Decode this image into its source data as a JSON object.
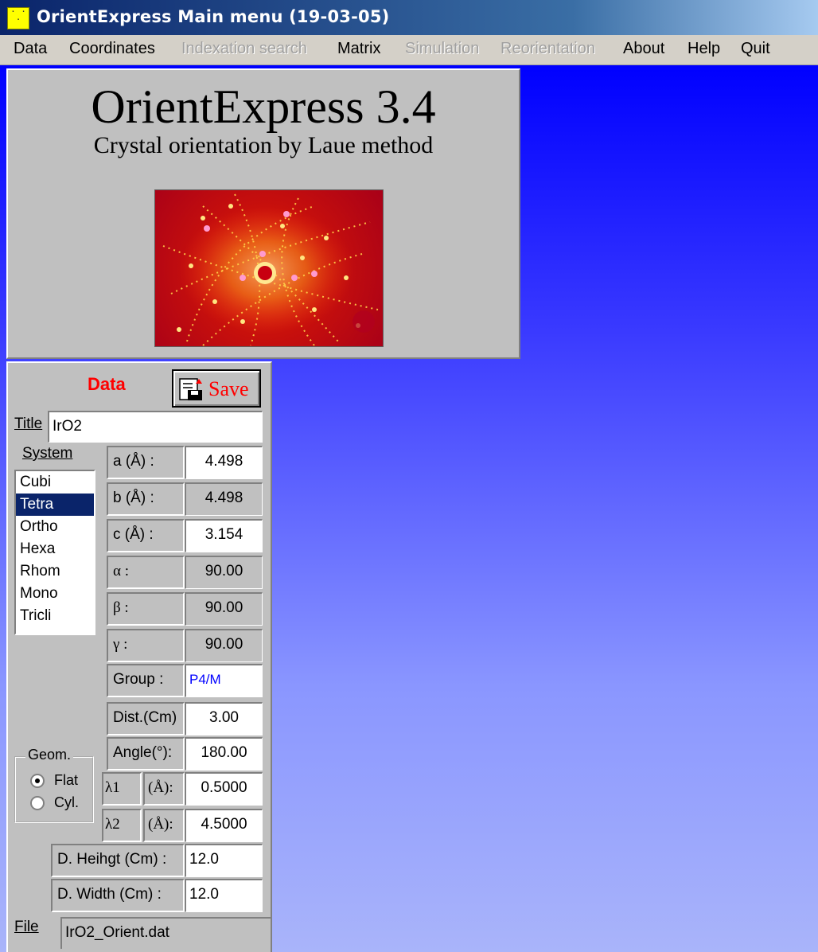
{
  "window": {
    "title": "OrientExpress Main menu (19-03-05)",
    "icon": "app-dots-icon"
  },
  "menu": [
    {
      "label": "Data",
      "enabled": true
    },
    {
      "label": "Coordinates",
      "enabled": true
    },
    {
      "label": "Indexation search",
      "enabled": false
    },
    {
      "label": "Matrix",
      "enabled": true
    },
    {
      "label": "Simulation",
      "enabled": false
    },
    {
      "label": "Reorientation",
      "enabled": false
    },
    {
      "label": "About",
      "enabled": true
    },
    {
      "label": "Help",
      "enabled": true
    },
    {
      "label": "Quit",
      "enabled": true
    }
  ],
  "splash": {
    "app_name": "OrientExpress 3.4",
    "subtitle": "Crystal orientation by Laue method",
    "image": "laue-pattern-image"
  },
  "data_panel": {
    "heading": "Data",
    "save_label": "Save",
    "title_label": "Title",
    "title_value": "IrO2",
    "system_label": "System",
    "systems": [
      "Cubi",
      "Tetra",
      "Ortho",
      "Hexa",
      "Rhom",
      "Mono",
      "Tricli"
    ],
    "selected_system": "Tetra",
    "params": {
      "a_label": "a (Å) :",
      "a_value": "4.498",
      "b_label": "b (Å) :",
      "b_value": "4.498",
      "c_label": "c (Å) :",
      "c_value": "3.154",
      "alpha_label": "α :",
      "alpha_value": "90.00",
      "beta_label": "β :",
      "beta_value": "90.00",
      "gamma_label": "γ :",
      "gamma_value": "90.00",
      "group_label": "Group :",
      "group_value": "P4/M",
      "dist_label": "Dist.(Cm)",
      "dist_value": "3.00",
      "angle_label": "Angle(°):",
      "angle_value": "180.00",
      "lambda1_label": "λ1",
      "lambda1_unit": "(Å):",
      "lambda1_value": "0.5000",
      "lambda2_label": "λ2",
      "lambda2_unit": "(Å):",
      "lambda2_value": "4.5000",
      "dheight_label": "D. Heihgt  (Cm) :",
      "dheight_value": "12.0",
      "dwidth_label": "D. Width (Cm) :",
      "dwidth_value": "12.0"
    },
    "geom": {
      "label": "Geom.",
      "options": [
        "Flat",
        "Cyl."
      ],
      "selected": "Flat"
    },
    "file_label": "File",
    "file_value": "IrO2_Orient.dat"
  },
  "colors": {
    "titlebar": "#0a246a",
    "desktop_top": "#0000ff",
    "desktop_bottom": "#a9b4fa",
    "accent_red": "#ff0000",
    "selection": "#0a246a",
    "group_text": "#0000ff"
  }
}
